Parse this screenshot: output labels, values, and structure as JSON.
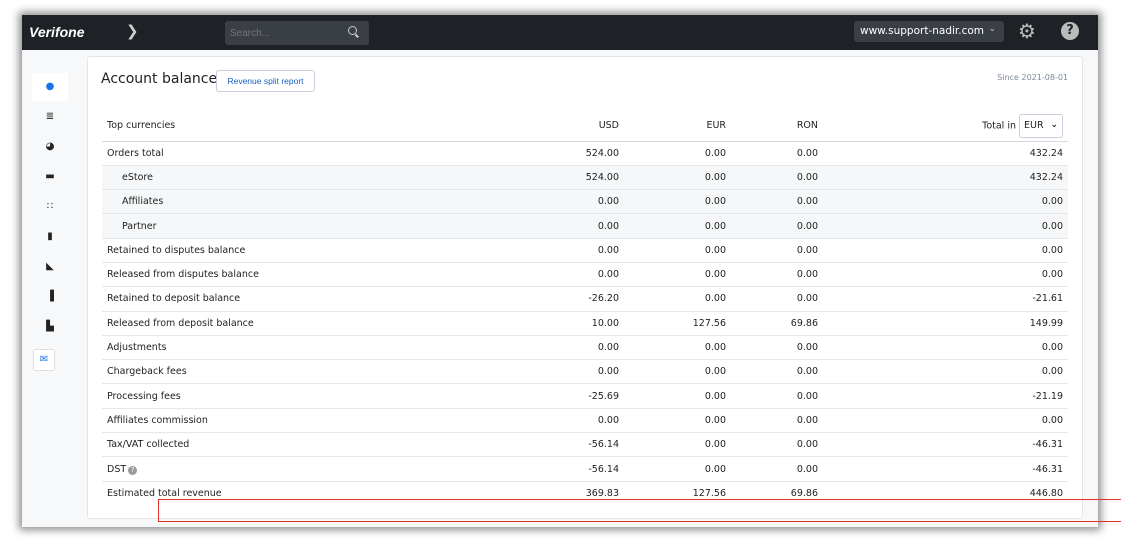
{
  "header": {
    "logo": "Verifone",
    "search_placeholder": "Search...",
    "site": "www.support-nadir.com"
  },
  "sidebar": {
    "items": [
      "dashboard-icon",
      "settings-sliders-icon",
      "pie-chart-icon",
      "handshake-icon",
      "sitemap-icon",
      "clipboard-icon",
      "plug-icon",
      "signal-chart-icon",
      "building-icon",
      "mail-icon"
    ]
  },
  "card": {
    "title": "Account balance",
    "revenue_button": "Revenue split report",
    "since": "Since 2021-08-01"
  },
  "table": {
    "headers": [
      "Top currencies",
      "USD",
      "EUR",
      "RON",
      "Total in"
    ],
    "currency_select": "EUR",
    "rows": [
      {
        "label": "Orders total",
        "usd": "524.00",
        "eur": "0.00",
        "ron": "0.00",
        "total": "432.24",
        "style": "bold"
      },
      {
        "label": "eStore",
        "usd": "524.00",
        "eur": "0.00",
        "ron": "0.00",
        "total": "432.24",
        "style": "sub"
      },
      {
        "label": "Affiliates",
        "usd": "0.00",
        "eur": "0.00",
        "ron": "0.00",
        "total": "0.00",
        "style": "sub"
      },
      {
        "label": "Partner",
        "usd": "0.00",
        "eur": "0.00",
        "ron": "0.00",
        "total": "0.00",
        "style": "sub"
      },
      {
        "label": "Retained to disputes balance",
        "usd": "0.00",
        "eur": "0.00",
        "ron": "0.00",
        "total": "0.00"
      },
      {
        "label": "Released from disputes balance",
        "usd": "0.00",
        "eur": "0.00",
        "ron": "0.00",
        "total": "0.00"
      },
      {
        "label": "Retained to deposit balance",
        "usd": "-26.20",
        "eur": "0.00",
        "ron": "0.00",
        "total": "-21.61"
      },
      {
        "label": "Released from deposit balance",
        "usd": "10.00",
        "eur": "127.56",
        "ron": "69.86",
        "total": "149.99"
      },
      {
        "label": "Adjustments",
        "usd": "0.00",
        "eur": "0.00",
        "ron": "0.00",
        "total": "0.00"
      },
      {
        "label": "Chargeback fees",
        "usd": "0.00",
        "eur": "0.00",
        "ron": "0.00",
        "total": "0.00"
      },
      {
        "label": "Processing fees",
        "usd": "-25.69",
        "eur": "0.00",
        "ron": "0.00",
        "total": "-21.19"
      },
      {
        "label": "Affiliates commission",
        "usd": "0.00",
        "eur": "0.00",
        "ron": "0.00",
        "total": "0.00"
      },
      {
        "label": "Tax/VAT collected",
        "usd": "-56.14",
        "eur": "0.00",
        "ron": "0.00",
        "total": "-46.31"
      },
      {
        "label": "DST",
        "usd": "-56.14",
        "eur": "0.00",
        "ron": "0.00",
        "total": "-46.31",
        "help": true,
        "highlight_color": "#e0312b"
      },
      {
        "label": "Estimated total revenue",
        "usd": "369.83",
        "eur": "127.56",
        "ron": "69.86",
        "total": "446.80",
        "style": "bold last"
      }
    ]
  }
}
